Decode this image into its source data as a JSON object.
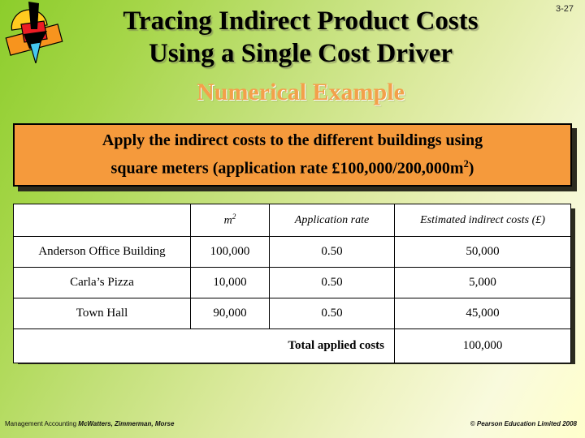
{
  "slide": {
    "number": "3-27",
    "title_lines": [
      "Tracing Indirect Product Costs",
      "Using a Single Cost Driver"
    ],
    "subtitle": "Numerical Example",
    "logo_name": "pearson-abstract-logo"
  },
  "callout": {
    "line1": "Apply the indirect costs to the different buildings using",
    "line2_prefix": "square meters (application rate £100,000/200,000m",
    "line2_sup": "2",
    "line2_suffix": ")"
  },
  "table": {
    "headers": {
      "name": "",
      "m2_prefix": "m",
      "m2_sup": "2",
      "rate": "Application rate",
      "cost": "Estimated indirect costs (£)"
    },
    "rows": [
      {
        "name": "Anderson Office Building",
        "m2": "100,000",
        "rate": "0.50",
        "cost": "50,000"
      },
      {
        "name": "Carla’s Pizza",
        "m2": "10,000",
        "rate": "0.50",
        "cost": "5,000"
      },
      {
        "name": "Town Hall",
        "m2": "90,000",
        "rate": "0.50",
        "cost": "45,000"
      }
    ],
    "total": {
      "label": "Total applied costs",
      "cost": "100,000"
    }
  },
  "footer": {
    "left_regular": "Management Accounting ",
    "left_italic": "McWatters, Zimmerman, Morse",
    "right": "© Pearson Education Limited  2008"
  },
  "colors": {
    "background_start": "#8ccd2b",
    "background_end": "#ffffcc",
    "callout_fill": "#f59a3c",
    "subtitle": "#f3a04b",
    "table_fill": "#ffffff",
    "text": "#000000"
  }
}
